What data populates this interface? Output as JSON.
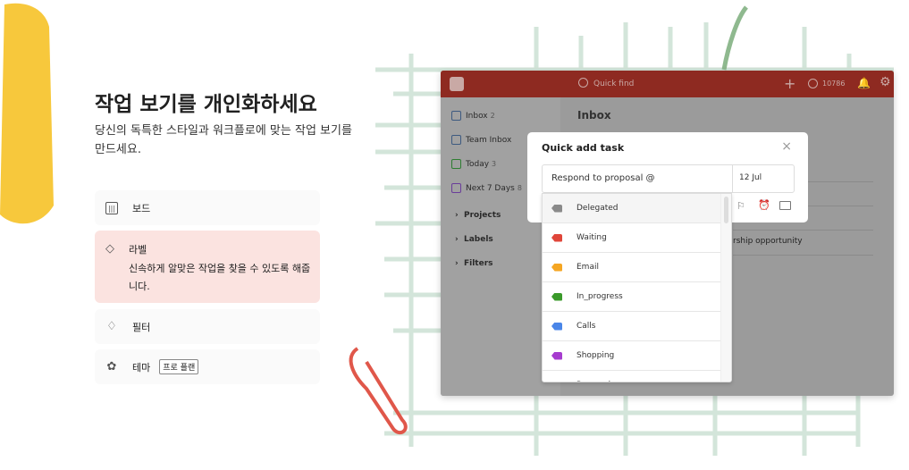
{
  "hero": {
    "title": "작업 보기를 개인화하세요",
    "subtitle": "당신의 독특한 스타일과 워크플로에 맞는 작업 보기를 만드세요."
  },
  "features": [
    {
      "label": "보드",
      "icon": "board-icon"
    },
    {
      "label": "라벨",
      "description": "신속하게 알맞은 작업을 찾을 수 있도록 해줍니다.",
      "icon": "tag-icon",
      "active": true
    },
    {
      "label": "필터",
      "icon": "drop-icon"
    },
    {
      "label": "테마",
      "badge": "프로 플랜",
      "icon": "palette-icon"
    }
  ],
  "app": {
    "header": {
      "search_placeholder": "Quick find",
      "karma": "10786"
    },
    "sidebar": [
      {
        "label": "Inbox",
        "count": "2",
        "color": "#3d5a80"
      },
      {
        "label": "Team Inbox",
        "count": "",
        "color": "#3d5a80"
      },
      {
        "label": "Today",
        "count": "3",
        "color": "#2e7d32"
      },
      {
        "label": "Next 7 Days",
        "count": "8",
        "color": "#6a3d9a"
      }
    ],
    "sections": [
      "Projects",
      "Labels",
      "Filters"
    ],
    "main_title": "Inbox",
    "task_fragment": "rship opportunity"
  },
  "modal": {
    "title": "Quick add task",
    "input_value": "Respond to proposal @",
    "date": "12 Jul",
    "labels": [
      {
        "name": "Delegated",
        "color": "#8a8a8a"
      },
      {
        "name": "Waiting",
        "color": "#e0463a"
      },
      {
        "name": "Email",
        "color": "#f5a623"
      },
      {
        "name": "In_progress",
        "color": "#3a9a2a"
      },
      {
        "name": "Calls",
        "color": "#4a86e8"
      },
      {
        "name": "Shopping",
        "color": "#a63ccf"
      },
      {
        "name": "Research",
        "color": "#f08a78"
      }
    ]
  },
  "colors": {
    "brand": "#db4c3f",
    "accent_card": "#fbe3e0"
  }
}
